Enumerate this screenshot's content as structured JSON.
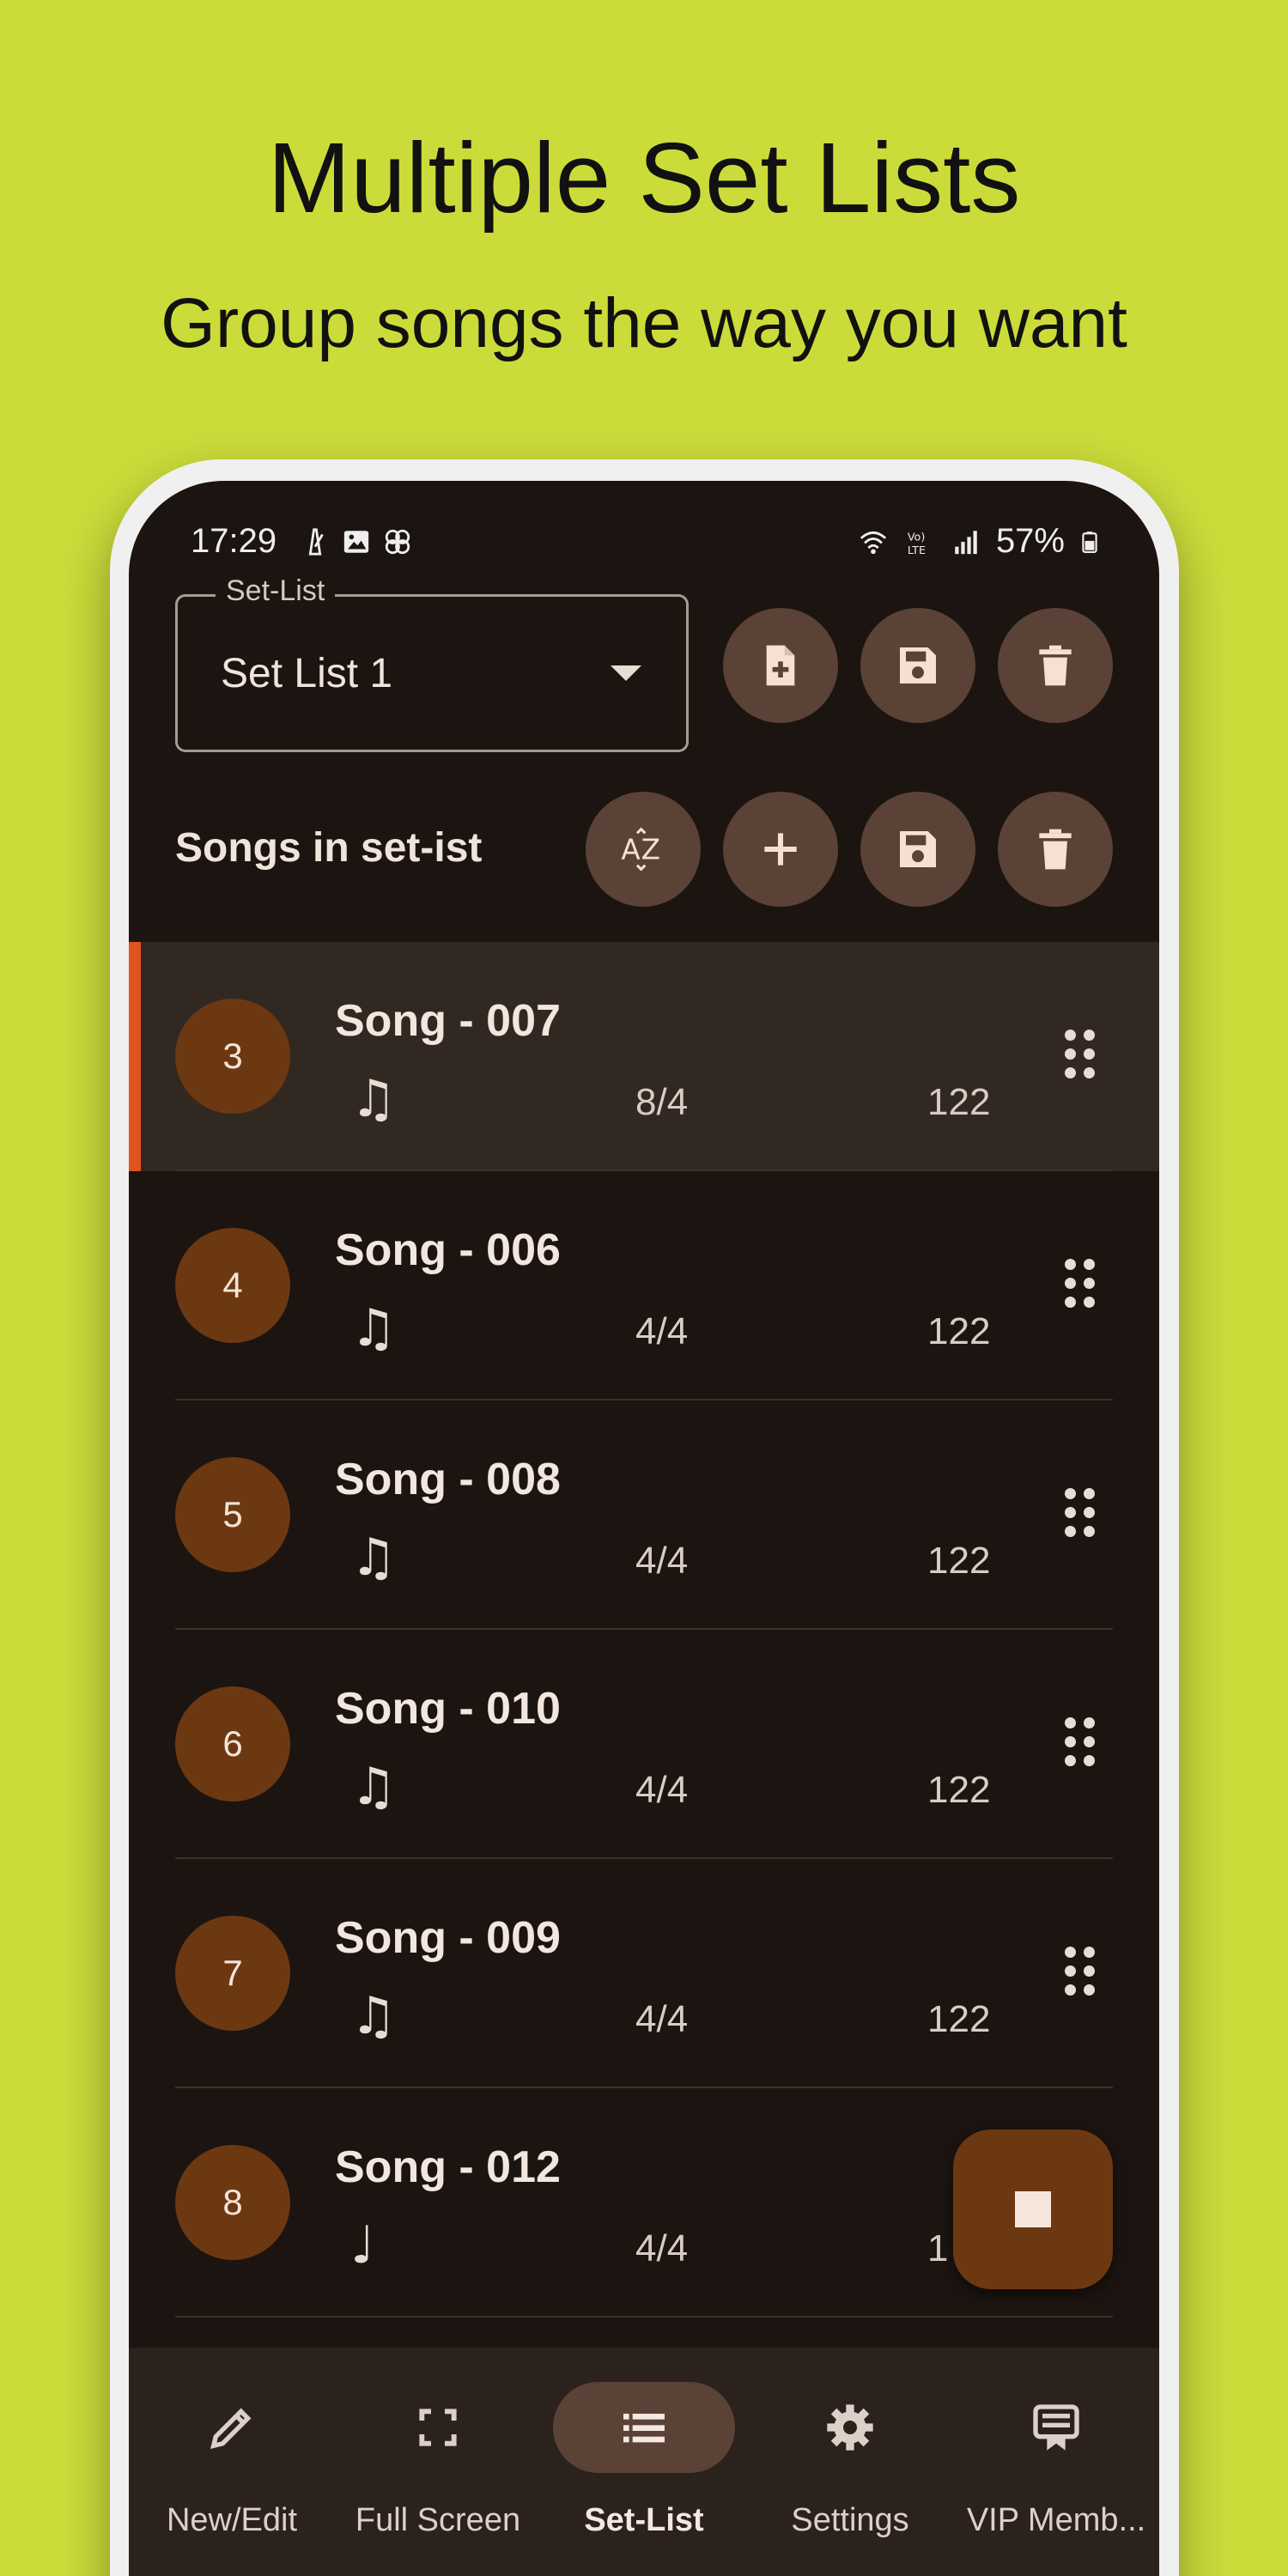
{
  "promo": {
    "title": "Multiple Set Lists",
    "subtitle": "Group songs the way you want"
  },
  "statusbar": {
    "time": "17:29",
    "battery": "57%"
  },
  "setlist": {
    "label": "Set-List",
    "value": "Set List 1"
  },
  "songs_heading": "Songs in set-ist",
  "songs": [
    {
      "number": "3",
      "title": "Song - 007",
      "meter": "8/4",
      "bpm": "122",
      "icon": "♫"
    },
    {
      "number": "4",
      "title": "Song - 006",
      "meter": "4/4",
      "bpm": "122",
      "icon": "♫"
    },
    {
      "number": "5",
      "title": "Song - 008",
      "meter": "4/4",
      "bpm": "122",
      "icon": "♫"
    },
    {
      "number": "6",
      "title": "Song - 010",
      "meter": "4/4",
      "bpm": "122",
      "icon": "♫"
    },
    {
      "number": "7",
      "title": "Song - 009",
      "meter": "4/4",
      "bpm": "122",
      "icon": "♫"
    },
    {
      "number": "8",
      "title": "Song - 012",
      "meter": "4/4",
      "bpm": "1",
      "icon": "♩"
    }
  ],
  "nav": [
    {
      "label": "New/Edit",
      "icon": "pencil-icon"
    },
    {
      "label": "Full Screen",
      "icon": "fullscreen-icon"
    },
    {
      "label": "Set-List",
      "icon": "list-icon"
    },
    {
      "label": "Settings",
      "icon": "gear-icon"
    },
    {
      "label": "VIP Memb...",
      "icon": "vip-badge-icon"
    }
  ],
  "colors": {
    "background": "#cbdc3a",
    "screen": "#1c1410",
    "accent": "#6c3812",
    "active_marker": "#e0541e",
    "button": "#5a4236"
  }
}
